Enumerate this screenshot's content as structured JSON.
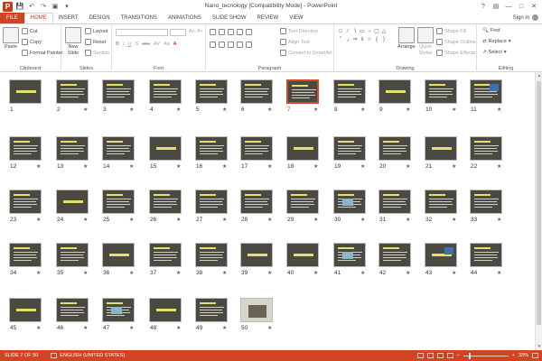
{
  "window": {
    "title": "Nano_tecnology [Compatibility Mode] - PowerPoint",
    "signin": "Sign in"
  },
  "qat": {
    "save_icon": "save-icon",
    "undo_icon": "undo-icon",
    "redo_icon": "redo-icon"
  },
  "tabs": [
    "FILE",
    "HOME",
    "INSERT",
    "DESIGN",
    "TRANSITIONS",
    "ANIMATIONS",
    "SLIDE SHOW",
    "REVIEW",
    "VIEW"
  ],
  "active_tab": "HOME",
  "ribbon": {
    "clipboard": {
      "label": "Clipboard",
      "paste": "Paste",
      "cut": "Cut",
      "copy": "Copy",
      "format_painter": "Format Painter"
    },
    "slides": {
      "label": "Slides",
      "new_slide": "New",
      "new_slide2": "Slide",
      "layout": "Layout",
      "reset": "Reset",
      "section": "Section"
    },
    "font": {
      "label": "Font"
    },
    "paragraph": {
      "label": "Paragraph",
      "text_direction": "Text Direction",
      "align_text": "Align Text",
      "convert_smartart": "Convert to SmartArt"
    },
    "drawing": {
      "label": "Drawing",
      "arrange": "Arrange",
      "quick_styles": "Quick",
      "quick_styles2": "Styles",
      "shape_fill": "Shape Fill",
      "shape_outline": "Shape Outline",
      "shape_effects": "Shape Effects"
    },
    "editing": {
      "label": "Editing",
      "find": "Find",
      "replace": "Replace",
      "select": "Select"
    }
  },
  "slides": [
    "1",
    "2",
    "3",
    "4",
    "5",
    "6",
    "7",
    "8",
    "9",
    "10",
    "11",
    "12",
    "13",
    "14",
    "15",
    "16",
    "17",
    "18",
    "19",
    "20",
    "21",
    "22",
    "23",
    "24",
    "25",
    "26",
    "27",
    "28",
    "29",
    "30",
    "31",
    "32",
    "33",
    "34",
    "35",
    "36",
    "37",
    "38",
    "39",
    "40",
    "41",
    "42",
    "43",
    "44",
    "45",
    "46",
    "47",
    "48",
    "49",
    "50"
  ],
  "selected_slide": "7",
  "status": {
    "slide_info": "SLIDE 7 OF 50",
    "language": "ENGLISH (UNITED STATES)",
    "zoom": "33%"
  },
  "colors": {
    "accent": "#d04423",
    "slide_bg": "#4a4a42",
    "slide_title": "#e6e06a"
  }
}
